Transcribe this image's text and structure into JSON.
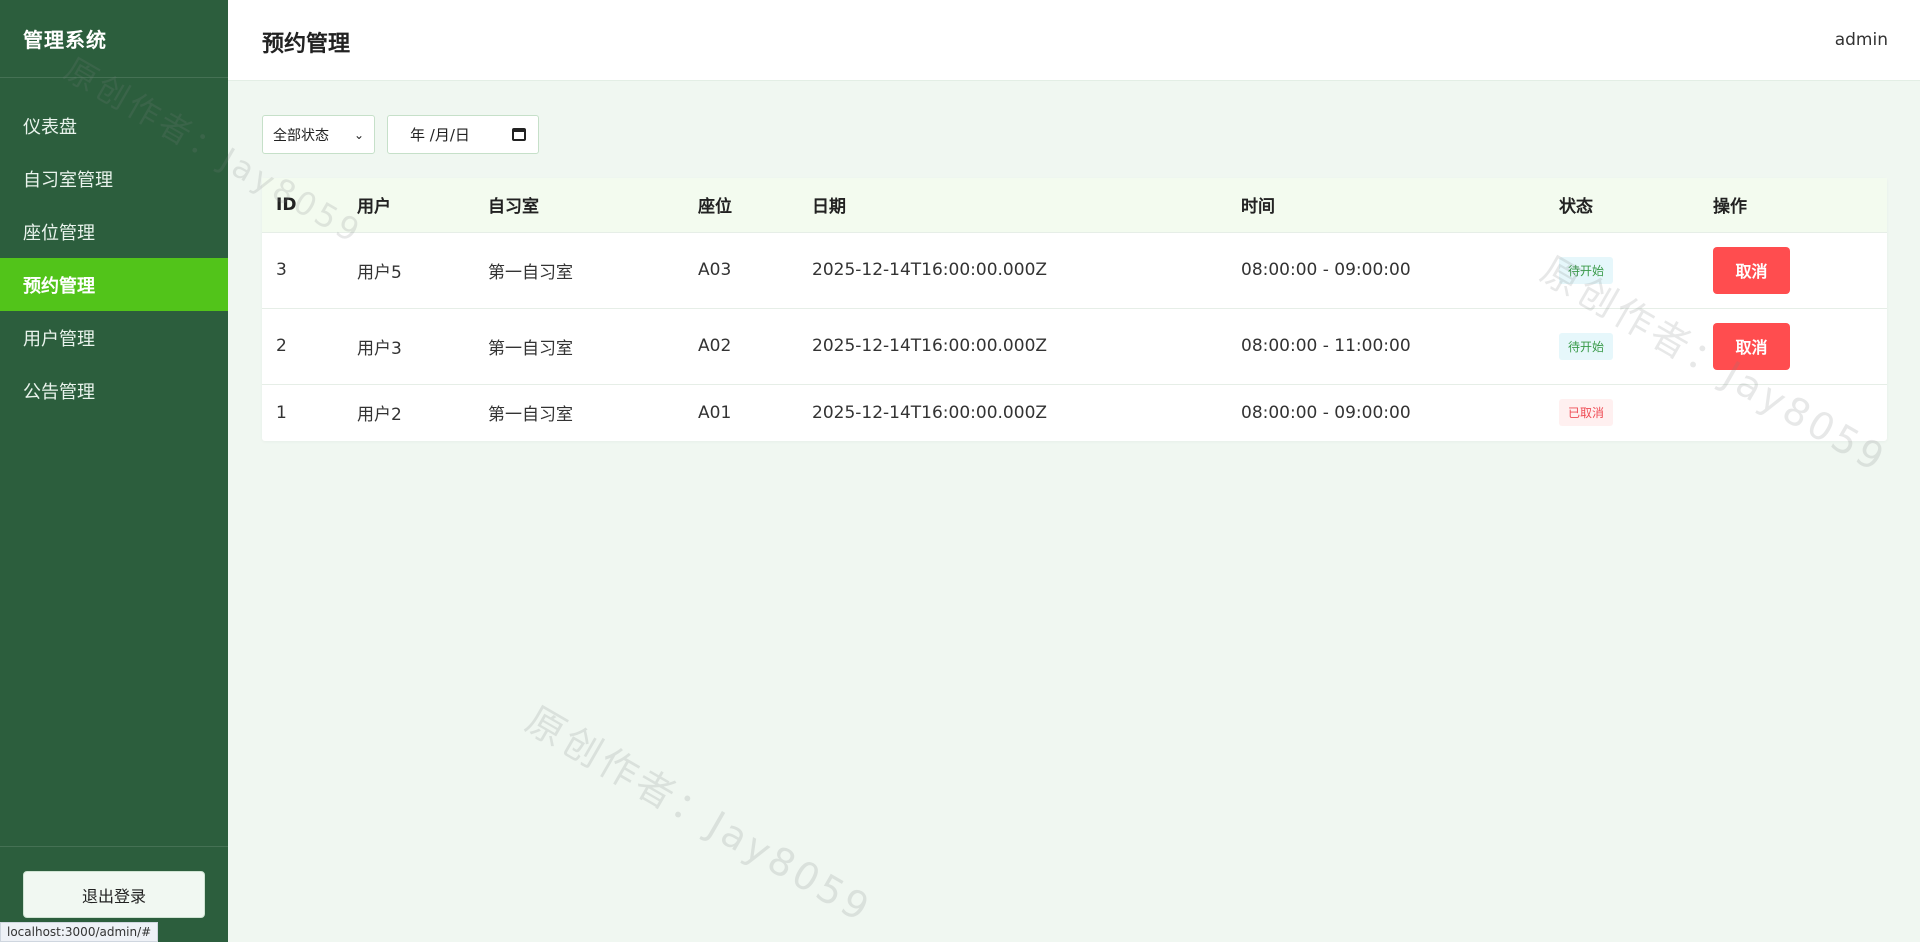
{
  "sidebar": {
    "brand": "管理系统",
    "items": [
      {
        "label": "仪表盘"
      },
      {
        "label": "自习室管理"
      },
      {
        "label": "座位管理"
      },
      {
        "label": "预约管理"
      },
      {
        "label": "用户管理"
      },
      {
        "label": "公告管理"
      }
    ],
    "active_index": 3,
    "logout_label": "退出登录"
  },
  "header": {
    "title": "预约管理",
    "user": "admin"
  },
  "filters": {
    "status_selected": "全部状态",
    "date_placeholder": "年 /月/日"
  },
  "table": {
    "columns": [
      "ID",
      "用户",
      "自习室",
      "座位",
      "日期",
      "时间",
      "状态",
      "操作"
    ],
    "rows": [
      {
        "id": "3",
        "user": "用户5",
        "room": "第一自习室",
        "seat": "A03",
        "date": "2025-12-14T16:00:00.000Z",
        "time": "08:00:00 - 09:00:00",
        "status": "待开始",
        "action": "取消"
      },
      {
        "id": "2",
        "user": "用户3",
        "room": "第一自习室",
        "seat": "A02",
        "date": "2025-12-14T16:00:00.000Z",
        "time": "08:00:00 - 11:00:00",
        "status": "待开始",
        "action": "取消"
      },
      {
        "id": "1",
        "user": "用户2",
        "room": "第一自习室",
        "seat": "A01",
        "date": "2025-12-14T16:00:00.000Z",
        "time": "08:00:00 - 09:00:00",
        "status": "已取消",
        "action": ""
      }
    ]
  },
  "statusbar": {
    "url": "localhost:3000/admin/#"
  },
  "watermark": "原创作者：Jay8059",
  "colors": {
    "sidebar_bg": "#2c5e3d",
    "active_nav": "#52c41a",
    "danger": "#ff4d4f",
    "content_bg": "#f0f7f1"
  }
}
